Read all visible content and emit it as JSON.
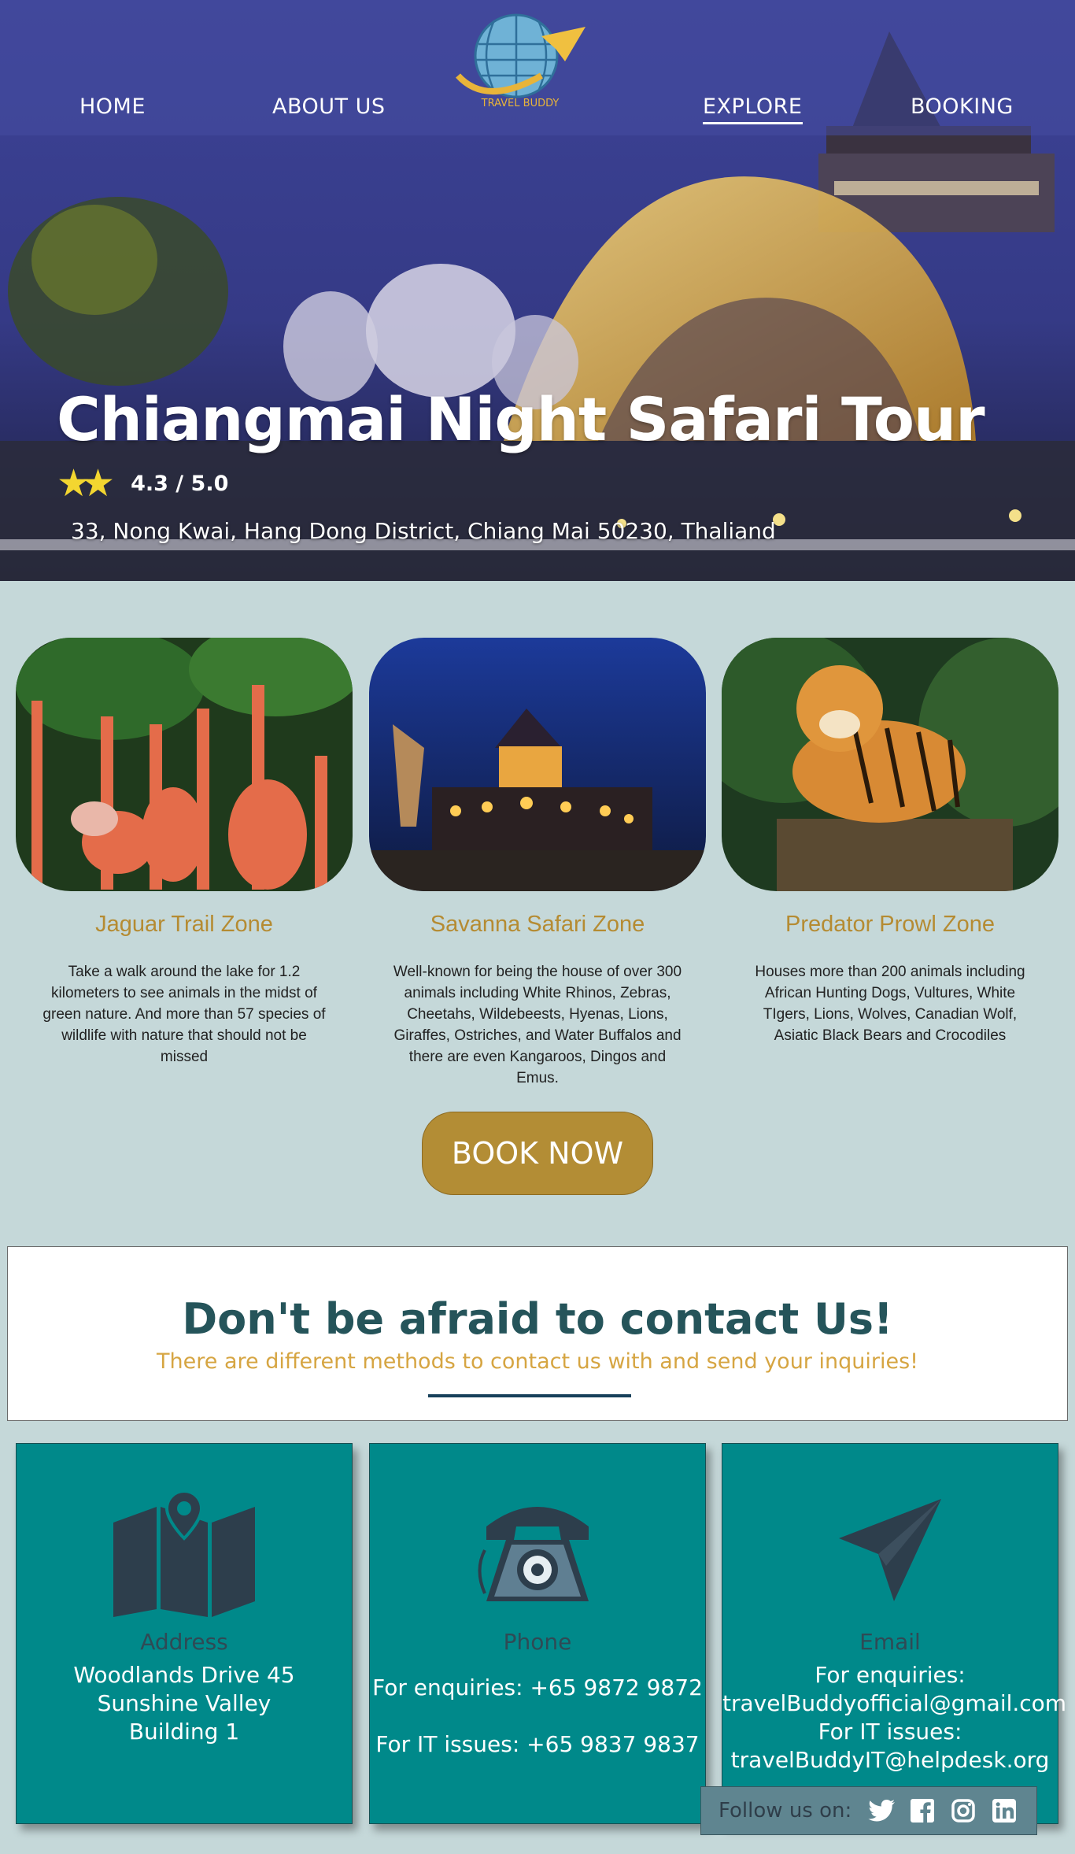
{
  "nav": {
    "home": "HOME",
    "about": "ABOUT US",
    "explore": "EXPLORE",
    "booking": "BOOKING",
    "logo_text": "TRAVEL BUDDY"
  },
  "hero": {
    "title": "Chiangmai Night Safari Tour",
    "rating_text": "4.3 / 5.0",
    "rating_value": 4.3,
    "rating_max": 5.0,
    "address": "33, Nong Kwai, Hang Dong District, Chiang Mai 50230, Thaliand"
  },
  "zones": [
    {
      "title": "Jaguar Trail Zone",
      "description": "Take a walk around the lake for 1.2 kilometers to see animals in the midst of green nature. And more than 57 species of wildlife with nature that should not be missed"
    },
    {
      "title": "Savanna Safari Zone",
      "description": "Well-known for being the house of over 300 animals including White Rhinos, Zebras, Cheetahs, Wildebeests, Hyenas, Lions, Giraffes, Ostriches, and Water Buffalos and there are even Kangaroos, Dingos and Emus."
    },
    {
      "title": "Predator Prowl Zone",
      "description": "Houses more than 200 animals including African Hunting Dogs, Vultures, White TIgers, Lions, Wolves, Canadian Wolf, Asiatic Black Bears and Crocodiles"
    }
  ],
  "book_button": "BOOK NOW",
  "contact": {
    "title": "Don't be afraid to contact Us!",
    "subtitle": "There are different methods to contact us with and send your inquiries!"
  },
  "cards": {
    "address": {
      "label": "Address",
      "line1": "Woodlands Drive 45",
      "line2": "Sunshine Valley",
      "line3": "Building 1"
    },
    "phone": {
      "label": "Phone",
      "enquiries": "For enquiries: +65 9872 9872",
      "it": "For IT issues: +65 9837 9837"
    },
    "email": {
      "label": "Email",
      "enquiries_label": "For enquiries:",
      "enquiries_email": "travelBuddyofficial@gmail.com",
      "it_label": "For IT issues:",
      "it_email": "travelBuddyIT@helpdesk.org"
    }
  },
  "follow": {
    "label": "Follow us on:",
    "icons": [
      "twitter-icon",
      "facebook-icon",
      "instagram-icon",
      "linkedin-icon"
    ]
  },
  "colors": {
    "background": "#c5d8d9",
    "accent_gold": "#b38d35",
    "teal_card": "#00898a",
    "heading_teal": "#25545a",
    "subtitle_gold": "#d6a542",
    "star": "#f3d630"
  }
}
